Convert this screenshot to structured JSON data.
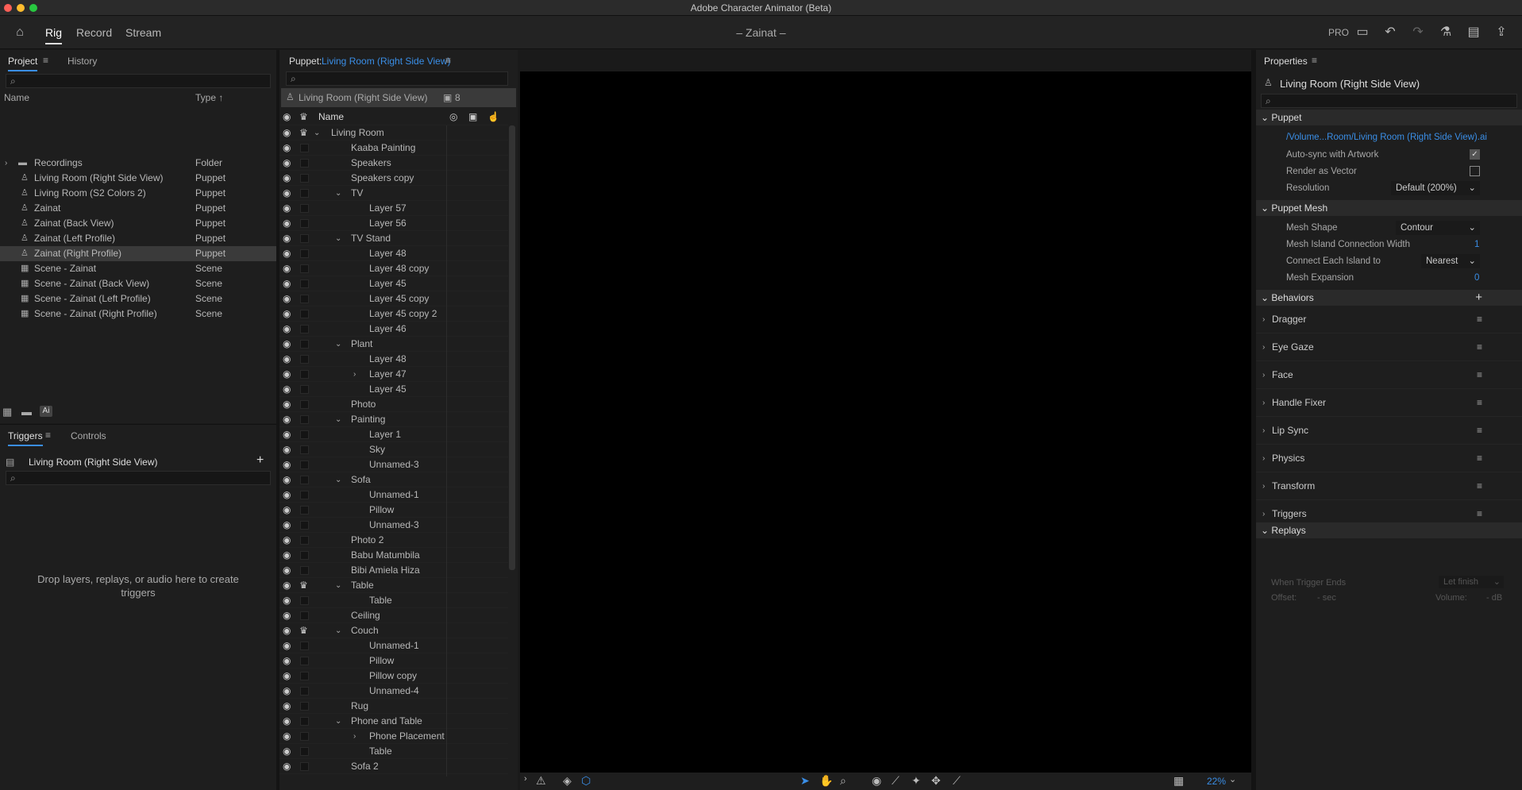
{
  "window": {
    "title": "Adobe Character Animator (Beta)"
  },
  "toolbar": {
    "tabs": [
      "Rig",
      "Record",
      "Stream"
    ],
    "active_tab": "Rig",
    "doc_title": "– Zainat –",
    "pro_label": "PRO"
  },
  "project_panel": {
    "tabs": [
      "Project",
      "History"
    ],
    "col_name": "Name",
    "col_type": "Type",
    "items": [
      {
        "name": "Recordings",
        "type": "Folder",
        "icon": "folder-icon"
      },
      {
        "name": "Living Room (Right Side View)",
        "type": "Puppet",
        "icon": "puppet-icon"
      },
      {
        "name": "Living Room (S2 Colors 2)",
        "type": "Puppet",
        "icon": "puppet-icon"
      },
      {
        "name": "Zainat",
        "type": "Puppet",
        "icon": "puppet-icon"
      },
      {
        "name": "Zainat (Back View)",
        "type": "Puppet",
        "icon": "puppet-icon"
      },
      {
        "name": "Zainat (Left Profile)",
        "type": "Puppet",
        "icon": "puppet-icon"
      },
      {
        "name": "Zainat (Right Profile)",
        "type": "Puppet",
        "icon": "puppet-icon"
      },
      {
        "name": "Scene - Zainat",
        "type": "Scene",
        "icon": "scene-icon"
      },
      {
        "name": "Scene - Zainat (Back View)",
        "type": "Scene",
        "icon": "scene-icon"
      },
      {
        "name": "Scene - Zainat (Left Profile)",
        "type": "Scene",
        "icon": "scene-icon"
      },
      {
        "name": "Scene - Zainat (Right Profile)",
        "type": "Scene",
        "icon": "scene-icon"
      }
    ],
    "footer_ai": "Ai"
  },
  "triggers_panel": {
    "tabs": [
      "Triggers",
      "Controls"
    ],
    "puppet": "Living Room (Right Side View)",
    "empty_text": "Drop layers, replays, or audio here to create triggers"
  },
  "puppet_panel": {
    "label": "Puppet:",
    "puppet_name": "Living Room (Right Side View)",
    "header_name": "Living Room (Right Side View)",
    "count": "8",
    "col_name": "Name",
    "layers": [
      {
        "name": "Living Room",
        "indent": 0,
        "chev": "down",
        "crown": true
      },
      {
        "name": "Kaaba Painting",
        "indent": 1
      },
      {
        "name": "Speakers",
        "indent": 1
      },
      {
        "name": "Speakers copy",
        "indent": 1
      },
      {
        "name": "TV",
        "indent": 1,
        "chev": "down"
      },
      {
        "name": "Layer 57",
        "indent": 2
      },
      {
        "name": "Layer 56",
        "indent": 2
      },
      {
        "name": "TV Stand",
        "indent": 1,
        "chev": "down"
      },
      {
        "name": "Layer 48",
        "indent": 2
      },
      {
        "name": "Layer 48 copy",
        "indent": 2
      },
      {
        "name": "Layer 45",
        "indent": 2
      },
      {
        "name": "Layer 45 copy",
        "indent": 2
      },
      {
        "name": "Layer 45 copy 2",
        "indent": 2
      },
      {
        "name": "Layer 46",
        "indent": 2
      },
      {
        "name": "Plant",
        "indent": 1,
        "chev": "down"
      },
      {
        "name": "Layer 48",
        "indent": 2
      },
      {
        "name": "Layer 47",
        "indent": 2,
        "chev": "right"
      },
      {
        "name": "Layer 45",
        "indent": 2
      },
      {
        "name": "Photo",
        "indent": 1
      },
      {
        "name": "Painting",
        "indent": 1,
        "chev": "down"
      },
      {
        "name": "Layer 1",
        "indent": 2
      },
      {
        "name": "Sky",
        "indent": 2
      },
      {
        "name": "Unnamed-3",
        "indent": 2
      },
      {
        "name": "Sofa",
        "indent": 1,
        "chev": "down"
      },
      {
        "name": "Unnamed-1",
        "indent": 2
      },
      {
        "name": "Pillow",
        "indent": 2
      },
      {
        "name": "Unnamed-3",
        "indent": 2
      },
      {
        "name": "Photo 2",
        "indent": 1
      },
      {
        "name": "Babu Matumbila",
        "indent": 1
      },
      {
        "name": "Bibi Amiela Hiza",
        "indent": 1
      },
      {
        "name": "Table",
        "indent": 1,
        "chev": "down",
        "crown": true
      },
      {
        "name": "Table",
        "indent": 2
      },
      {
        "name": "Ceiling",
        "indent": 1
      },
      {
        "name": "Couch",
        "indent": 1,
        "chev": "down",
        "crown": true
      },
      {
        "name": "Unnamed-1",
        "indent": 2
      },
      {
        "name": "Pillow",
        "indent": 2
      },
      {
        "name": "Pillow copy",
        "indent": 2
      },
      {
        "name": "Unnamed-4",
        "indent": 2
      },
      {
        "name": "Rug",
        "indent": 1
      },
      {
        "name": "Phone and Table",
        "indent": 1,
        "chev": "down"
      },
      {
        "name": "Phone Placement",
        "indent": 2,
        "chev": "right"
      },
      {
        "name": "Table",
        "indent": 2
      },
      {
        "name": "Sofa 2",
        "indent": 1
      }
    ]
  },
  "canvas": {
    "zoom": "22%"
  },
  "properties": {
    "title": "Properties",
    "puppet_name": "Living Room (Right Side View)",
    "puppet_section": "Puppet",
    "path": "/Volume...Room/Living Room (Right Side View).ai",
    "auto_sync": "Auto-sync with Artwork",
    "auto_sync_checked": true,
    "render_vector": "Render as Vector",
    "render_vector_checked": false,
    "resolution_label": "Resolution",
    "resolution_value": "Default (200%)",
    "mesh_section": "Puppet Mesh",
    "mesh_shape_label": "Mesh Shape",
    "mesh_shape_value": "Contour",
    "island_width_label": "Mesh Island Connection Width",
    "island_width_value": "1",
    "connect_label": "Connect Each Island to",
    "connect_value": "Nearest",
    "expansion_label": "Mesh Expansion",
    "expansion_value": "0",
    "behaviors_section": "Behaviors",
    "behaviors": [
      "Dragger",
      "Eye Gaze",
      "Face",
      "Handle Fixer",
      "Lip Sync",
      "Physics",
      "Transform",
      "Triggers"
    ],
    "replays_section": "Replays",
    "when_trigger_ends": "When Trigger Ends",
    "let_finish": "Let finish",
    "offset_label": "Offset:",
    "offset_value": "- sec",
    "volume_label": "Volume:",
    "volume_value": "- dB"
  },
  "colors": {
    "accent": "#3a8ee6",
    "link": "#3a8ee6",
    "bg": "#1e1e1e"
  }
}
